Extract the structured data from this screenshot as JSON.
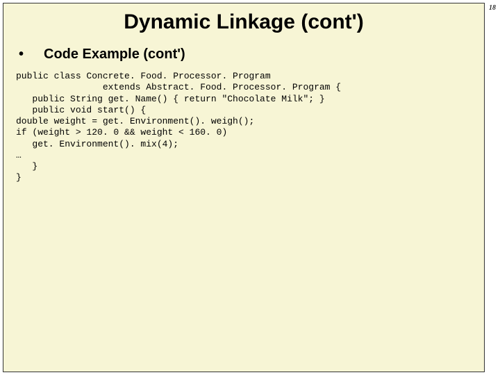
{
  "page_number": "18",
  "title": "Dynamic Linkage (cont')",
  "bullet": {
    "label": "Code Example (cont')"
  },
  "code": "public class Concrete. Food. Processor. Program\n                extends Abstract. Food. Processor. Program {\n   public String get. Name() { return \"Chocolate Milk\"; }\n   public void start() {\ndouble weight = get. Environment(). weigh();\nif (weight > 120. 0 && weight < 160. 0)\n   get. Environment(). mix(4);\n…\n   }\n}"
}
